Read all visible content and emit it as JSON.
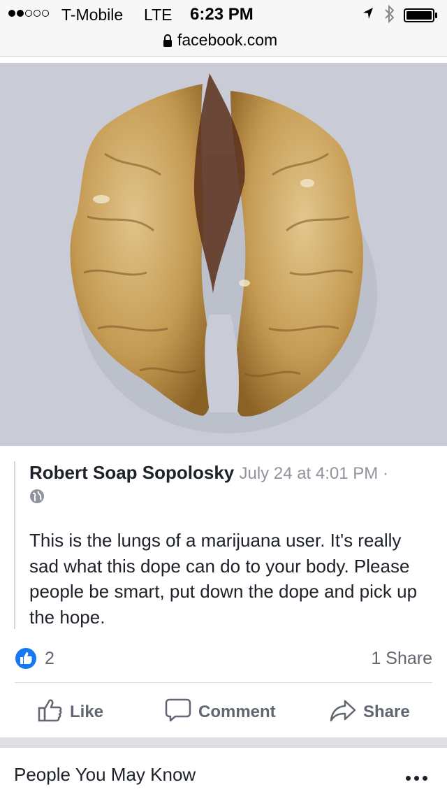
{
  "status_bar": {
    "signal_dots_filled": 2,
    "signal_dots_total": 5,
    "carrier": "T-Mobile",
    "network": "LTE",
    "time": "6:23 PM"
  },
  "browser": {
    "url": "facebook.com"
  },
  "post": {
    "author": "Robert Soap Sopolosky",
    "timestamp": "July 24 at 4:01 PM ·",
    "text": "This is the lungs of a marijuana user. It's really sad what this dope can do to your body. Please people be smart, put down the dope and pick up the hope.",
    "like_count": "2",
    "share_count": "1 Share"
  },
  "actions": {
    "like": "Like",
    "comment": "Comment",
    "share": "Share"
  },
  "next_section": {
    "title": "People You May Know"
  },
  "colors": {
    "facebook_blue": "#1877f2",
    "muted_text": "#606770",
    "photo_background": "#c9ccd6"
  },
  "icons": [
    "location-arrow-icon",
    "bluetooth-icon",
    "battery-icon",
    "lock-icon",
    "globe-icon",
    "like-reaction-icon",
    "thumbs-up-icon",
    "comment-icon",
    "share-arrow-icon",
    "more-dots-icon"
  ]
}
